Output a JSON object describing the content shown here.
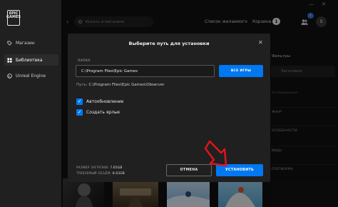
{
  "sidebar": {
    "logo_text": "EPIC GAMES",
    "items": [
      {
        "label": "Магазин",
        "icon": "tag-icon",
        "active": false
      },
      {
        "label": "Библиотека",
        "icon": "grid-icon",
        "active": true
      },
      {
        "label": "Unreal Engine",
        "icon": "unreal-icon",
        "active": false
      }
    ]
  },
  "topbar": {
    "search_placeholder": "Искать в магазине",
    "wishlist": "Список желаемого",
    "cart": "Корзина",
    "cart_count": "1",
    "friends_badge": "1",
    "avatar_letter": "S"
  },
  "background": {
    "filters_title": "Фильтры",
    "filter_search_placeholder": "Заголовок",
    "filter_caption": "Установленные",
    "filter_rows": [
      "ЖАНР",
      "ОСОБЕННОСТИ",
      "ВИДЫ",
      "ПЛАТФОРМА"
    ]
  },
  "modal": {
    "title": "Выберите путь для установки",
    "folder_label": "ПАПКА",
    "folder_value": "C:\\Program Files\\Epic Games",
    "browse_label": "ВСЕ ИГРЫ",
    "path_label": "Путь:",
    "path_value": "C:\\Program Files\\Epic Games\\Observer",
    "checkboxes": [
      {
        "label": "Автообновление",
        "checked": true
      },
      {
        "label": "Создать ярлык",
        "checked": true
      }
    ],
    "download_size_label": "РАЗМЕР ЗАГРУЗКИ:",
    "download_size_value": "7.65GB",
    "required_space_label": "ТРЕБУЕМЫЙ ОБЪЁМ:",
    "required_space_value": "8.63GB",
    "cancel_label": "ОТМЕНА",
    "install_label": "УСТАНОВИТЬ"
  },
  "colors": {
    "accent": "#0078f2",
    "annotation_arrow": "#e0141e"
  }
}
